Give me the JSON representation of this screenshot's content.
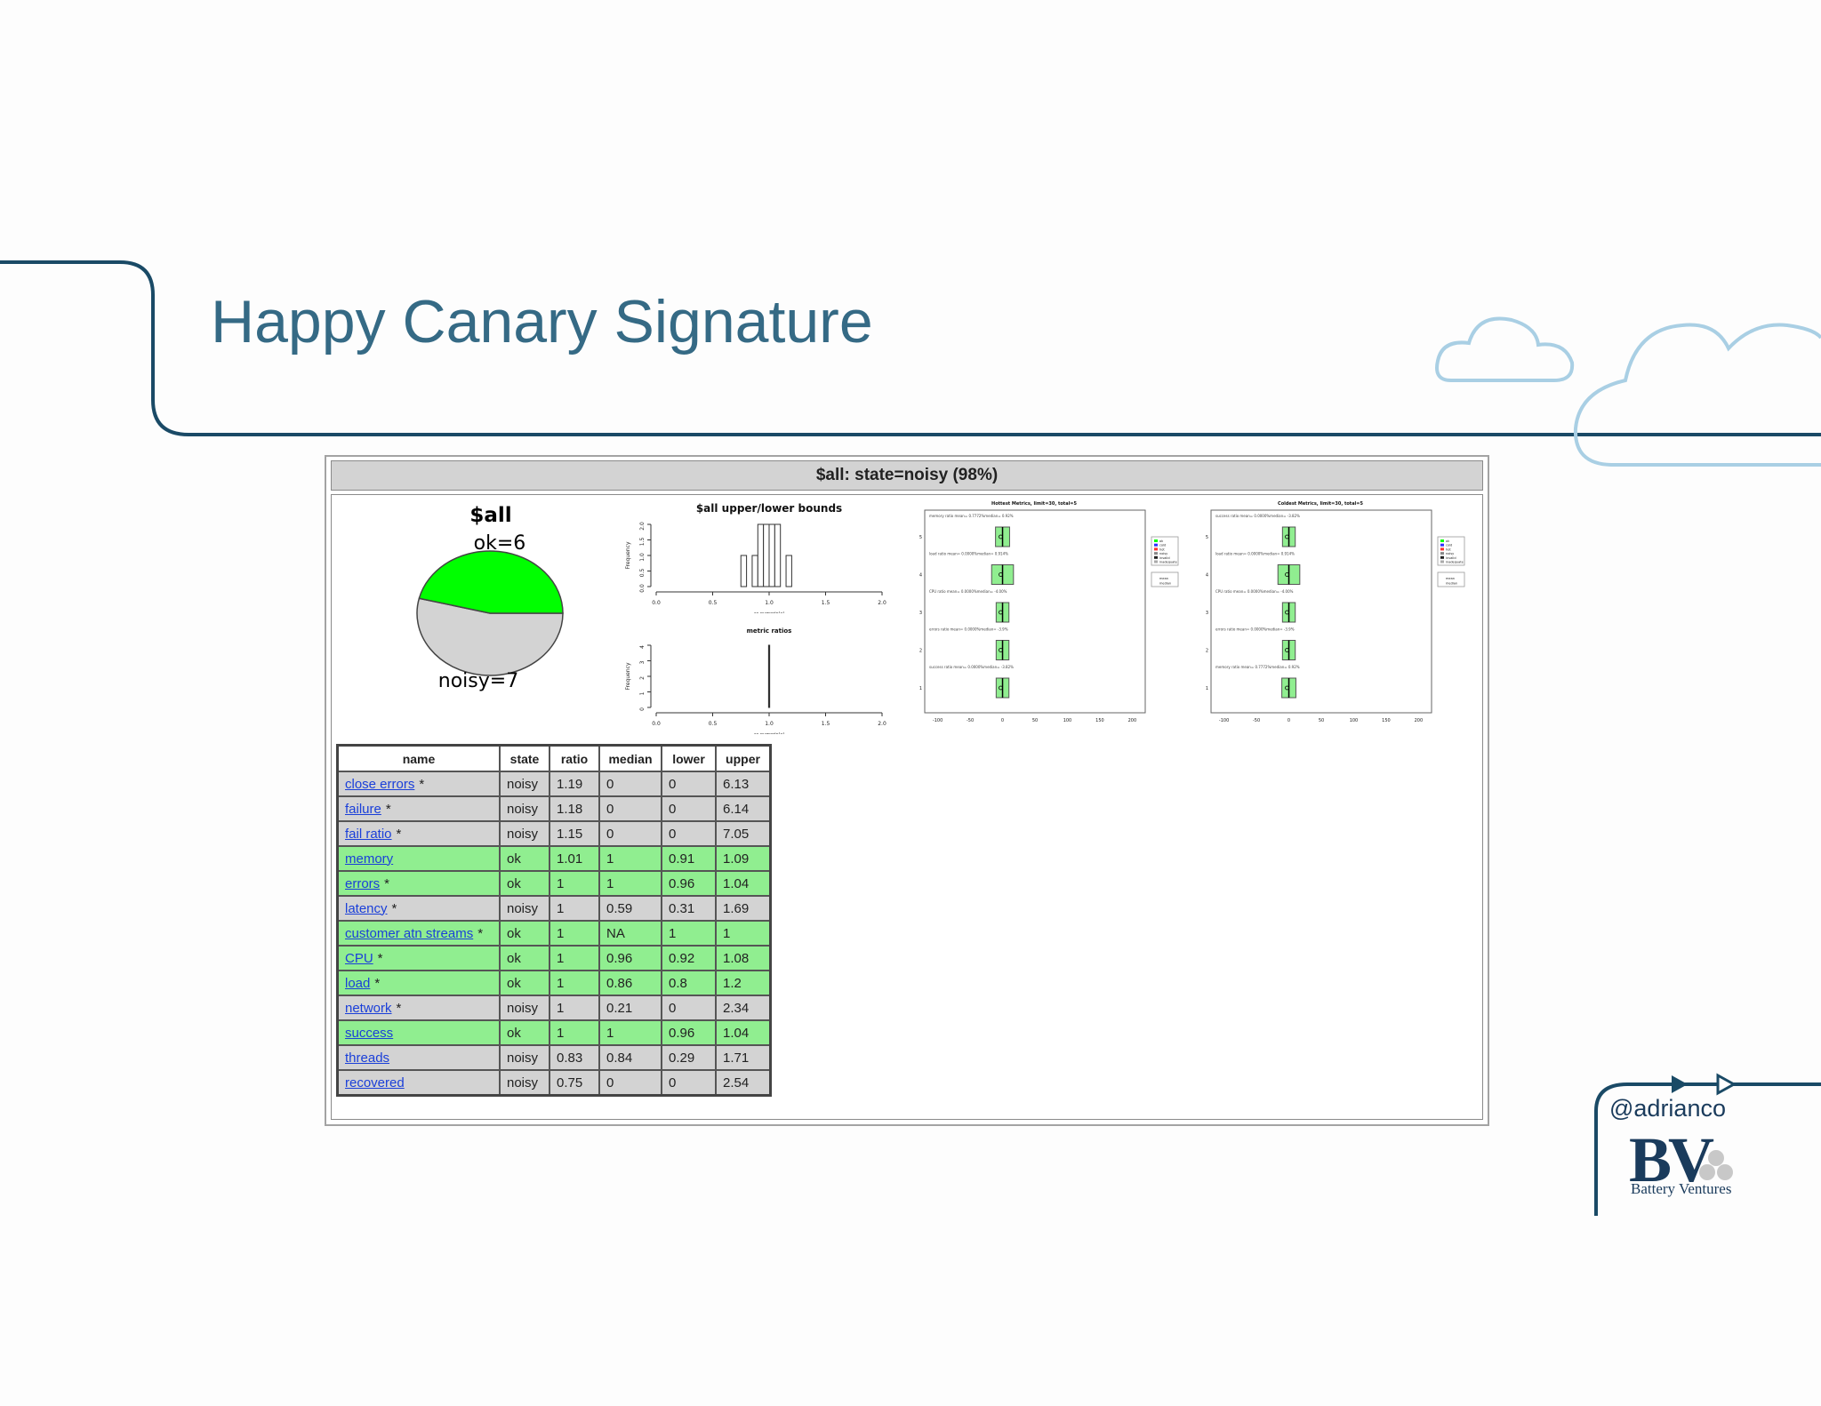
{
  "slide": {
    "title": "Happy Canary Signature",
    "handle": "@adrianco",
    "logo_text": "BV",
    "company": "Battery Ventures",
    "accent_color": "#1a4a66",
    "title_color": "#356a85",
    "cloud_color": "#a9cfe4"
  },
  "panel": {
    "header": "$all: state=noisy (98%)"
  },
  "chart_data": [
    {
      "type": "pie",
      "title": "$all",
      "labels": [
        "ok=6",
        "noisy=7"
      ],
      "slices": [
        {
          "name": "ok",
          "value": 6,
          "color": "#00ff00"
        },
        {
          "name": "noisy",
          "value": 7,
          "color": "#d3d3d3"
        }
      ]
    },
    {
      "type": "bar",
      "title": "$all upper/lower bounds",
      "ylabel": "Frequency",
      "xlabel": "as.numeric(x)",
      "x_ticks": [
        "0.0",
        "0.5",
        "1.0",
        "1.5",
        "2.0"
      ],
      "y_ticks": [
        "0.0",
        "0.5",
        "1.0",
        "1.5",
        "2.0"
      ],
      "xlim": [
        0,
        2
      ],
      "ylim": [
        0,
        2
      ],
      "bins": [
        {
          "x0": 0.75,
          "x1": 0.8,
          "count": 1
        },
        {
          "x0": 0.8,
          "x1": 0.85,
          "count": 0
        },
        {
          "x0": 0.85,
          "x1": 0.9,
          "count": 1
        },
        {
          "x0": 0.9,
          "x1": 0.95,
          "count": 2
        },
        {
          "x0": 0.95,
          "x1": 1.0,
          "count": 2
        },
        {
          "x0": 1.0,
          "x1": 1.05,
          "count": 2
        },
        {
          "x0": 1.05,
          "x1": 1.1,
          "count": 2
        },
        {
          "x0": 1.1,
          "x1": 1.15,
          "count": 0
        },
        {
          "x0": 1.15,
          "x1": 1.2,
          "count": 1
        }
      ]
    },
    {
      "type": "bar",
      "title": "metric ratios",
      "ylabel": "Frequency",
      "xlabel": "as.numeric(x)",
      "x_ticks": [
        "0.0",
        "0.5",
        "1.0",
        "1.5",
        "2.0"
      ],
      "y_ticks": [
        "0",
        "1",
        "2",
        "3",
        "4"
      ],
      "xlim": [
        0,
        2
      ],
      "ylim": [
        0,
        4
      ],
      "bins": [
        {
          "x0": 0.995,
          "x1": 1.005,
          "count": 4
        }
      ]
    },
    {
      "type": "box",
      "title": "Hottest Metrics, limit=30, total=5",
      "x_ticks": [
        "-100",
        "-50",
        "0",
        "50",
        "100",
        "150",
        "200"
      ],
      "y_ticks": [
        "1",
        "2",
        "3",
        "4",
        "5"
      ],
      "legend": [
        "ok",
        "cold",
        "hot",
        "noisy",
        "invalid",
        "inadequate",
        "mean",
        "median"
      ],
      "rows": [
        {
          "label": "memory ratio mean= 0.7772%median= 0.92%",
          "low": -4,
          "high": 4,
          "mid": 0
        },
        {
          "label": "load ratio mean= 0.0000%median= 0.914%",
          "low": -10,
          "high": 10,
          "mid": 0
        },
        {
          "label": "CPU ratio mean= 0.0000%median= -4.00%",
          "low": -3,
          "high": 3,
          "mid": 0
        },
        {
          "label": "errors ratio mean= 0.0000%median= -3.9%",
          "low": -3,
          "high": 3,
          "mid": 0
        },
        {
          "label": "success ratio mean= 0.0000%median= -3.82%",
          "low": -3,
          "high": 3,
          "mid": 0
        }
      ]
    },
    {
      "type": "box",
      "title": "Coldest Metrics, limit=30, total=5",
      "x_ticks": [
        "-100",
        "-50",
        "0",
        "50",
        "100",
        "150",
        "200"
      ],
      "y_ticks": [
        "1",
        "2",
        "3",
        "4",
        "5"
      ],
      "legend": [
        "ok",
        "cold",
        "hot",
        "noisy",
        "invalid",
        "inadequate",
        "mean",
        "median"
      ],
      "rows": [
        {
          "label": "success ratio mean= 0.0000%median= -3.82%",
          "low": -3,
          "high": 3,
          "mid": 0
        },
        {
          "label": "load ratio mean= 0.0000%median= 0.914%",
          "low": -10,
          "high": 10,
          "mid": 0
        },
        {
          "label": "CPU ratio mean= 0.0000%median= -4.00%",
          "low": -3,
          "high": 3,
          "mid": 0
        },
        {
          "label": "errors ratio mean= 0.0000%median= -3.9%",
          "low": -3,
          "high": 3,
          "mid": 0
        },
        {
          "label": "memory ratio mean= 0.7772%median= 0.92%",
          "low": -4,
          "high": 4,
          "mid": 0
        }
      ]
    },
    {
      "type": "table",
      "columns": [
        "name",
        "state",
        "ratio",
        "median",
        "lower",
        "upper"
      ],
      "rows": [
        {
          "name": "close errors",
          "star": "*",
          "state": "noisy",
          "ratio": "1.19",
          "median": "0",
          "lower": "0",
          "upper": "6.13"
        },
        {
          "name": "failure",
          "star": "*",
          "state": "noisy",
          "ratio": "1.18",
          "median": "0",
          "lower": "0",
          "upper": "6.14"
        },
        {
          "name": "fail ratio",
          "star": "*",
          "state": "noisy",
          "ratio": "1.15",
          "median": "0",
          "lower": "0",
          "upper": "7.05"
        },
        {
          "name": "memory",
          "star": "",
          "state": "ok",
          "ratio": "1.01",
          "median": "1",
          "lower": "0.91",
          "upper": "1.09"
        },
        {
          "name": "errors",
          "star": "*",
          "state": "ok",
          "ratio": "1",
          "median": "1",
          "lower": "0.96",
          "upper": "1.04"
        },
        {
          "name": "latency",
          "star": "*",
          "state": "noisy",
          "ratio": "1",
          "median": "0.59",
          "lower": "0.31",
          "upper": "1.69"
        },
        {
          "name": "customer atn streams",
          "star": "*",
          "state": "ok",
          "ratio": "1",
          "median": "NA",
          "lower": "1",
          "upper": "1"
        },
        {
          "name": "CPU",
          "star": "*",
          "state": "ok",
          "ratio": "1",
          "median": "0.96",
          "lower": "0.92",
          "upper": "1.08"
        },
        {
          "name": "load",
          "star": "*",
          "state": "ok",
          "ratio": "1",
          "median": "0.86",
          "lower": "0.8",
          "upper": "1.2"
        },
        {
          "name": "network",
          "star": "*",
          "state": "noisy",
          "ratio": "1",
          "median": "0.21",
          "lower": "0",
          "upper": "2.34"
        },
        {
          "name": "success",
          "star": "",
          "state": "ok",
          "ratio": "1",
          "median": "1",
          "lower": "0.96",
          "upper": "1.04"
        },
        {
          "name": "threads",
          "star": "",
          "state": "noisy",
          "ratio": "0.83",
          "median": "0.84",
          "lower": "0.29",
          "upper": "1.71"
        },
        {
          "name": "recovered",
          "star": "",
          "state": "noisy",
          "ratio": "0.75",
          "median": "0",
          "lower": "0",
          "upper": "2.54"
        }
      ]
    }
  ]
}
